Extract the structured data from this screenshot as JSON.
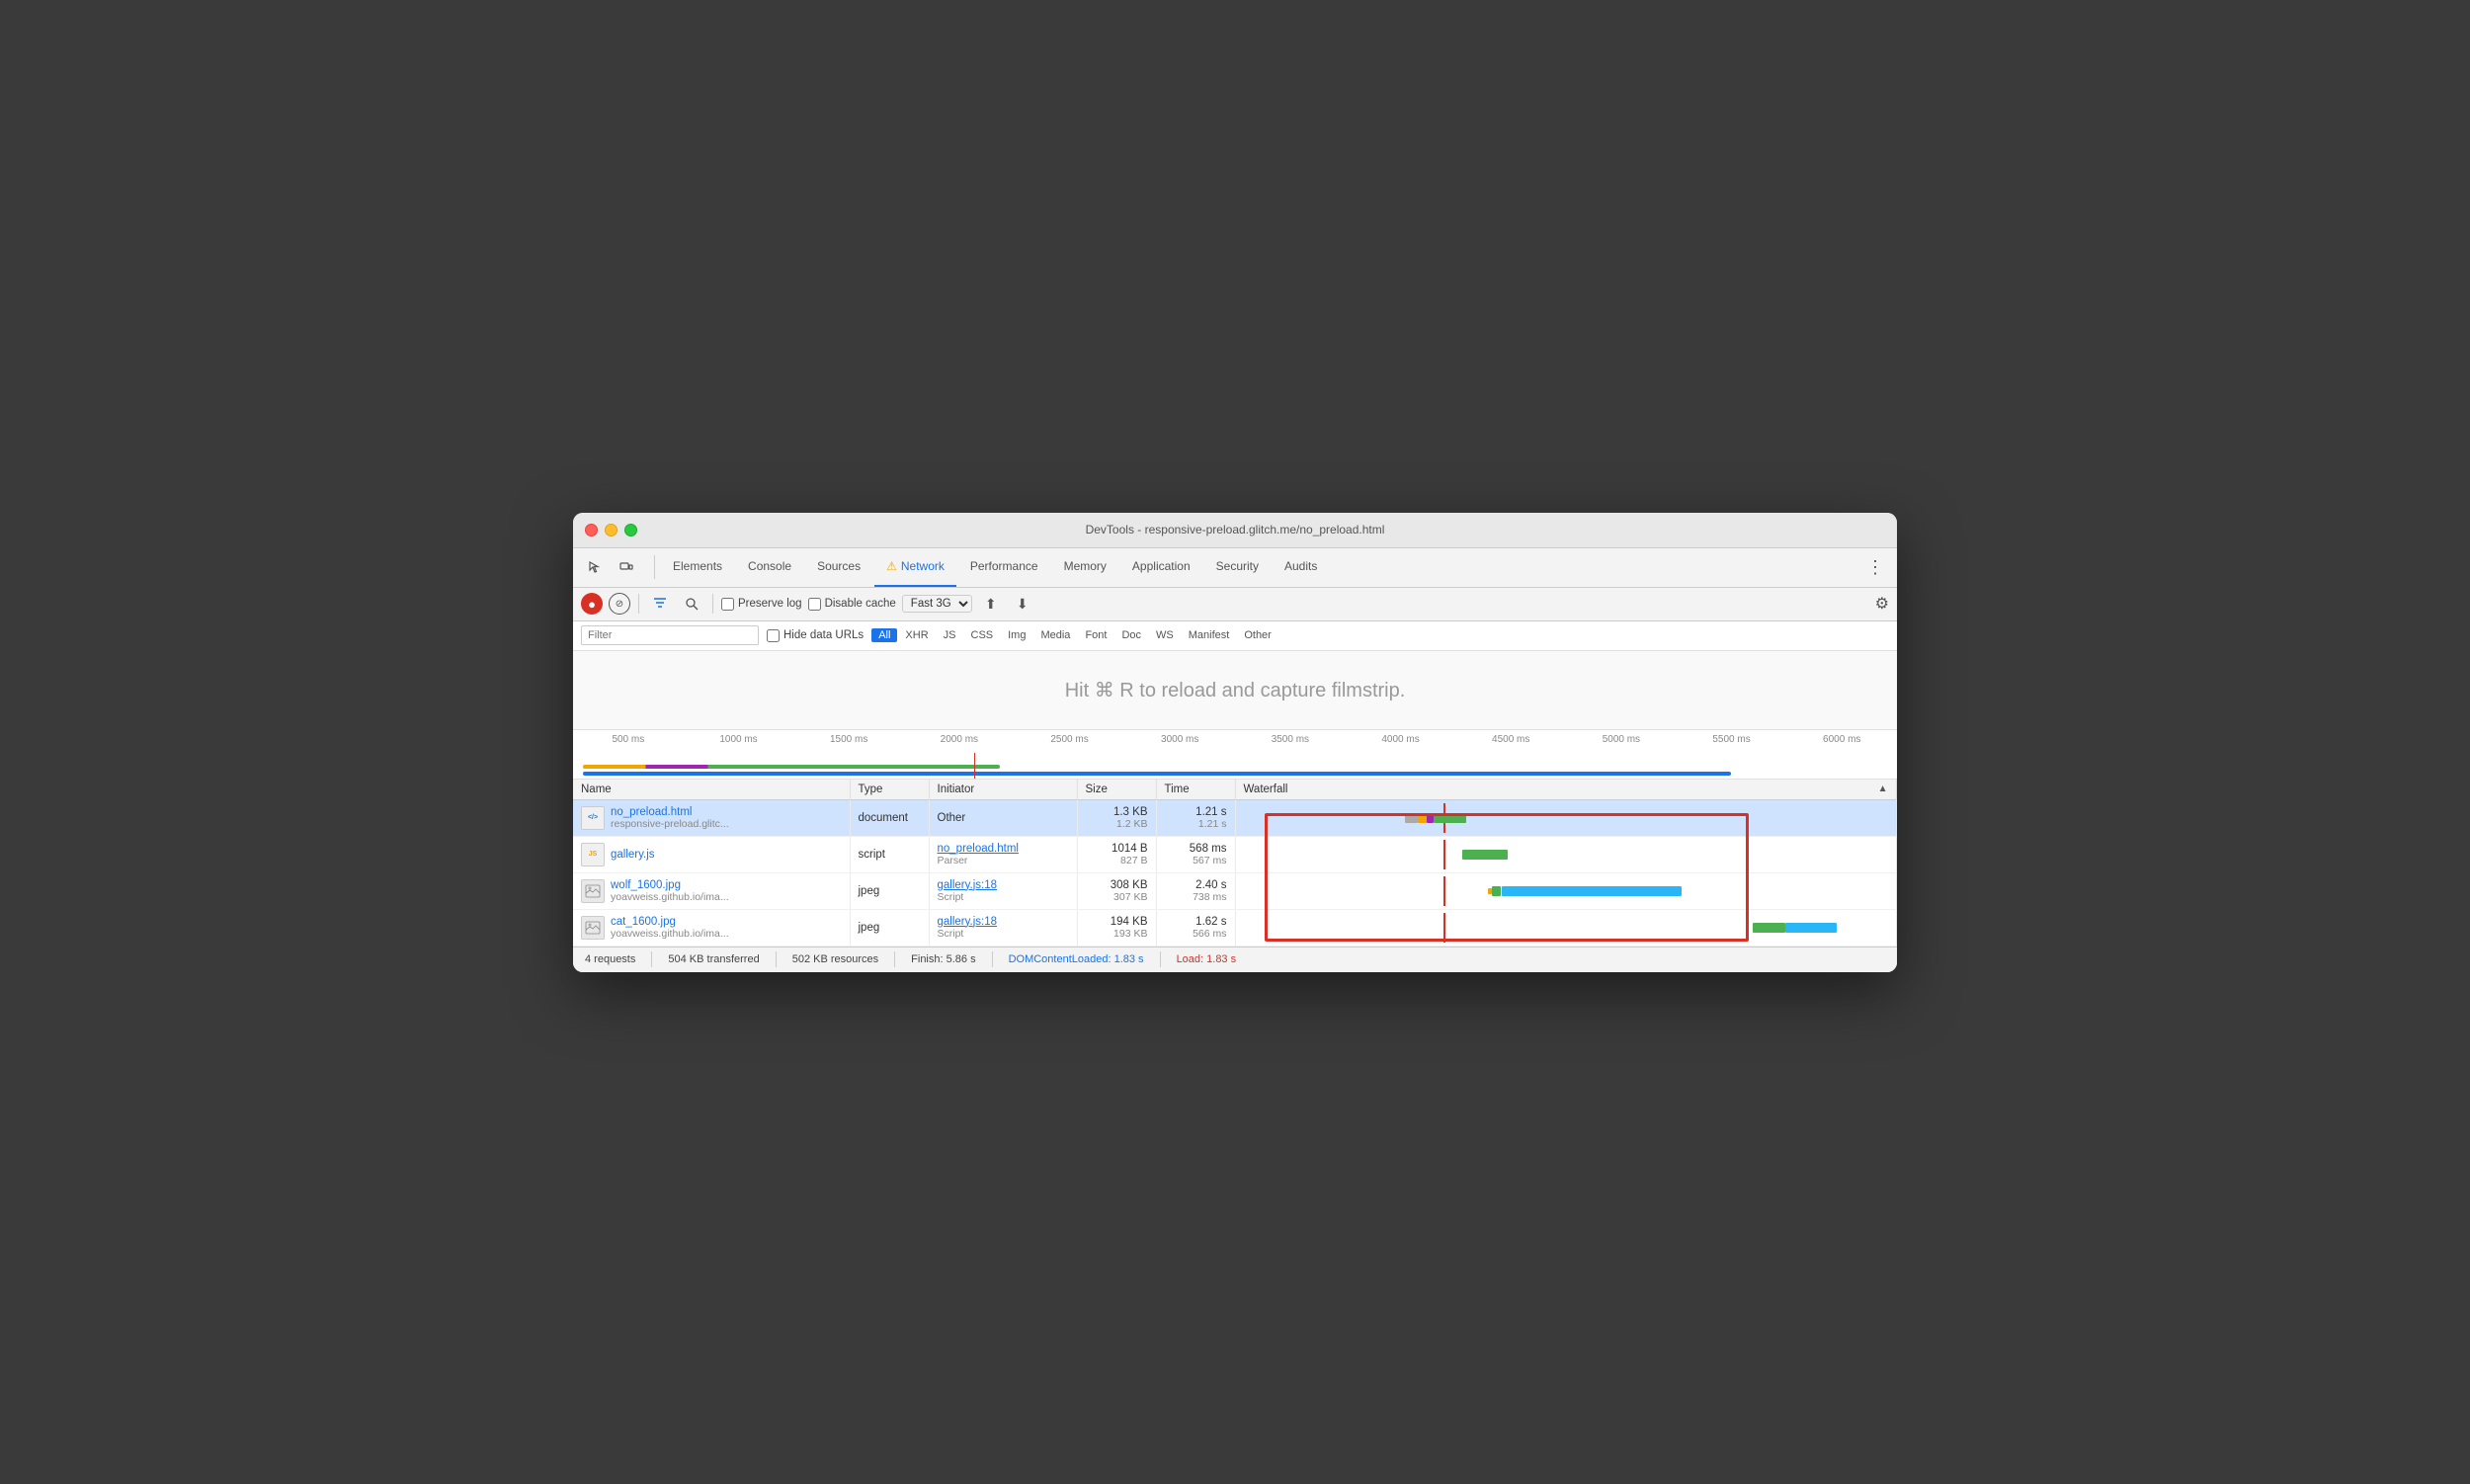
{
  "window": {
    "title": "DevTools - responsive-preload.glitch.me/no_preload.html"
  },
  "nav": {
    "tabs": [
      {
        "id": "elements",
        "label": "Elements",
        "active": false
      },
      {
        "id": "console",
        "label": "Console",
        "active": false
      },
      {
        "id": "sources",
        "label": "Sources",
        "active": false
      },
      {
        "id": "network",
        "label": "Network",
        "active": true,
        "warning": true
      },
      {
        "id": "performance",
        "label": "Performance",
        "active": false
      },
      {
        "id": "memory",
        "label": "Memory",
        "active": false
      },
      {
        "id": "application",
        "label": "Application",
        "active": false
      },
      {
        "id": "security",
        "label": "Security",
        "active": false
      },
      {
        "id": "audits",
        "label": "Audits",
        "active": false
      }
    ]
  },
  "toolbar": {
    "preserve_log": "Preserve log",
    "disable_cache": "Disable cache",
    "throttle": "Fast 3G"
  },
  "filter": {
    "placeholder": "Filter",
    "hide_data_urls": "Hide data URLs",
    "types": [
      "All",
      "XHR",
      "JS",
      "CSS",
      "Img",
      "Media",
      "Font",
      "Doc",
      "WS",
      "Manifest",
      "Other"
    ],
    "active_type": "All"
  },
  "filmstrip": {
    "hint": "Hit ⌘ R to reload and capture filmstrip."
  },
  "ruler": {
    "labels": [
      "500 ms",
      "1000 ms",
      "1500 ms",
      "2000 ms",
      "2500 ms",
      "3000 ms",
      "3500 ms",
      "4000 ms",
      "4500 ms",
      "5000 ms",
      "5500 ms",
      "6000 ms"
    ]
  },
  "table": {
    "headers": [
      "Name",
      "Type",
      "Initiator",
      "Size",
      "Time",
      "Waterfall"
    ],
    "rows": [
      {
        "name": "no_preload.html",
        "domain": "responsive-preload.glitc...",
        "icon": "html",
        "type": "document",
        "initiator": "Other",
        "initiator_sub": "",
        "size1": "1.3 KB",
        "size2": "1.2 KB",
        "time1": "1.21 s",
        "time2": "1.21 s",
        "selected": true
      },
      {
        "name": "gallery.js",
        "domain": "",
        "icon": "js",
        "type": "script",
        "initiator": "no_preload.html",
        "initiator_sub": "Parser",
        "size1": "1014 B",
        "size2": "827 B",
        "time1": "568 ms",
        "time2": "567 ms",
        "selected": false
      },
      {
        "name": "wolf_1600.jpg",
        "domain": "yoavweiss.github.io/ima...",
        "icon": "img",
        "type": "jpeg",
        "initiator": "gallery.js:18",
        "initiator_sub": "Script",
        "size1": "308 KB",
        "size2": "307 KB",
        "time1": "2.40 s",
        "time2": "738 ms",
        "selected": false
      },
      {
        "name": "cat_1600.jpg",
        "domain": "yoavweiss.github.io/ima...",
        "icon": "img",
        "type": "jpeg",
        "initiator": "gallery.js:18",
        "initiator_sub": "Script",
        "size1": "194 KB",
        "size2": "193 KB",
        "time1": "1.62 s",
        "time2": "566 ms",
        "selected": false
      }
    ]
  },
  "status": {
    "requests": "4 requests",
    "transferred": "504 KB transferred",
    "resources": "502 KB resources",
    "finish": "Finish: 5.86 s",
    "dom_content_loaded": "DOMContentLoaded: 1.83 s",
    "load": "Load: 1.83 s"
  }
}
